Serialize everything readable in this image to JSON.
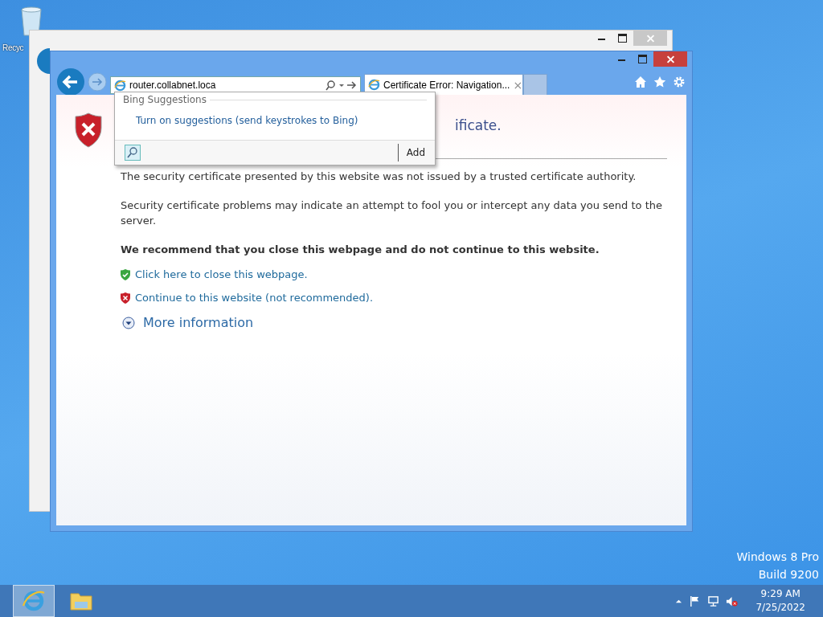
{
  "desktop": {
    "icons": [
      {
        "label": "Recyc"
      }
    ],
    "edition": [
      "Windows 8 Pro",
      "Build 9200"
    ]
  },
  "browser": {
    "address": "router.collabnet.loca",
    "tabs": [
      {
        "label": "Certificate Error: Navigation...",
        "selected": true,
        "close": "×"
      }
    ],
    "suggestions": {
      "header": "Bing Suggestions",
      "link": "Turn on suggestions (send keystrokes to Bing)",
      "add_button": "Add"
    },
    "page": {
      "heading": "ificate.",
      "paragraphs": [
        "The security certificate presented by this website was not issued by a trusted certificate authority.",
        "Security certificate problems may indicate an attempt to fool you or intercept any data you send to the server."
      ],
      "recommendation": "We recommend that you close this webpage and do not continue to this website.",
      "links": [
        {
          "kind": "safe",
          "label": "Click here to close this webpage."
        },
        {
          "kind": "unsafe",
          "label": "Continue to this website (not recommended)."
        }
      ],
      "more": "More information"
    }
  },
  "taskbar": {
    "apps": [
      {
        "kind": "browser",
        "selected": true
      },
      {
        "kind": "folder",
        "selected": false
      }
    ],
    "time": "9:29 AM",
    "date": "7/25/2022"
  }
}
